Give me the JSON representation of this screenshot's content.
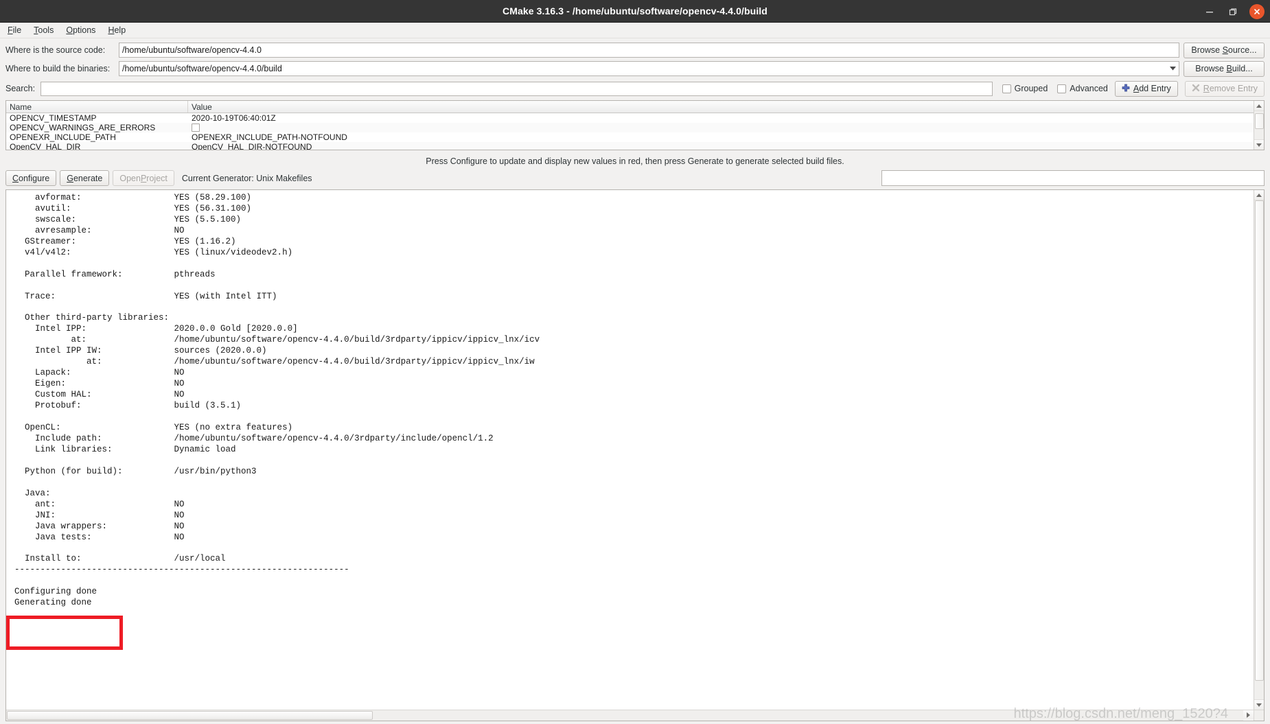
{
  "window": {
    "title": "CMake 3.16.3 - /home/ubuntu/software/opencv-4.4.0/build",
    "minimize_icon": "minimize-icon",
    "maximize_icon": "maximize-icon",
    "close_icon": "close-icon",
    "titlebar_color": "#353535",
    "close_button_color": "#e9552b"
  },
  "menubar": {
    "items": [
      {
        "label": "File",
        "mnemonic": "F"
      },
      {
        "label": "Tools",
        "mnemonic": "T"
      },
      {
        "label": "Options",
        "mnemonic": "O"
      },
      {
        "label": "Help",
        "mnemonic": "H"
      }
    ]
  },
  "paths": {
    "source_label": "Where is the source code:",
    "source_value": "/home/ubuntu/software/opencv-4.4.0",
    "source_browse_label": "Browse Source...",
    "source_browse_mnemonic": "S",
    "build_label": "Where to build the binaries:",
    "build_value": "/home/ubuntu/software/opencv-4.4.0/build",
    "build_browse_label": "Browse Build...",
    "build_browse_mnemonic": "B",
    "combo_arrow_icon": "chevron-down-icon"
  },
  "search": {
    "label": "Search:",
    "value": "",
    "placeholder": "",
    "grouped_label": "Grouped",
    "grouped_checked": false,
    "advanced_label": "Advanced",
    "advanced_checked": false,
    "add_entry_label": "Add Entry",
    "add_entry_mnemonic": "A",
    "add_entry_icon": "plus-icon",
    "remove_entry_label": "Remove Entry",
    "remove_entry_mnemonic": "R",
    "remove_entry_icon": "remove-x-icon",
    "remove_entry_enabled": false
  },
  "cache_table": {
    "columns": [
      "Name",
      "Value"
    ],
    "rows": [
      {
        "name": "OPENCV_TIMESTAMP",
        "value": "2020-10-19T06:40:01Z",
        "type": "text"
      },
      {
        "name": "OPENCV_WARNINGS_ARE_ERRORS",
        "value": "",
        "type": "checkbox",
        "checked": false
      },
      {
        "name": "OPENEXR_INCLUDE_PATH",
        "value": "OPENEXR_INCLUDE_PATH-NOTFOUND",
        "type": "text"
      },
      {
        "name": "OpenCV_HAL_DIR",
        "value": "OpenCV_HAL_DIR-NOTFOUND",
        "type": "text"
      }
    ]
  },
  "hint": {
    "text": "Press Configure to update and display new values in red, then press Generate to generate selected build files."
  },
  "actions": {
    "configure_label": "Configure",
    "configure_mnemonic": "C",
    "generate_label": "Generate",
    "generate_mnemonic": "G",
    "open_project_label": "Open Project",
    "open_project_enabled": false,
    "generator_text": "Current Generator: Unix Makefiles",
    "progress_value": ""
  },
  "log": {
    "content": "    avformat:                  YES (58.29.100)\n    avutil:                    YES (56.31.100)\n    swscale:                   YES (5.5.100)\n    avresample:                NO\n  GStreamer:                   YES (1.16.2)\n  v4l/v4l2:                    YES (linux/videodev2.h)\n\n  Parallel framework:          pthreads\n\n  Trace:                       YES (with Intel ITT)\n\n  Other third-party libraries:\n    Intel IPP:                 2020.0.0 Gold [2020.0.0]\n           at:                 /home/ubuntu/software/opencv-4.4.0/build/3rdparty/ippicv/ippicv_lnx/icv\n    Intel IPP IW:              sources (2020.0.0)\n              at:              /home/ubuntu/software/opencv-4.4.0/build/3rdparty/ippicv/ippicv_lnx/iw\n    Lapack:                    NO\n    Eigen:                     NO\n    Custom HAL:                NO\n    Protobuf:                  build (3.5.1)\n\n  OpenCL:                      YES (no extra features)\n    Include path:              /home/ubuntu/software/opencv-4.4.0/3rdparty/include/opencl/1.2\n    Link libraries:            Dynamic load\n\n  Python (for build):          /usr/bin/python3\n\n  Java:\n    ant:                       NO\n    JNI:                       NO\n    Java wrappers:             NO\n    Java tests:                NO\n\n  Install to:                  /usr/local\n-----------------------------------------------------------------\n\nConfiguring done\nGenerating done",
    "highlight_box_color": "#ee1c25",
    "highlighted_lines": [
      "Configuring done",
      "Generating done"
    ]
  },
  "scrollbars": {
    "up_arrow_icon": "caret-up-icon",
    "down_arrow_icon": "caret-down-icon",
    "left_arrow_icon": "caret-left-icon",
    "right_arrow_icon": "caret-right-icon"
  },
  "watermark": {
    "text": "https://blog.csdn.net/meng_1520?4"
  }
}
